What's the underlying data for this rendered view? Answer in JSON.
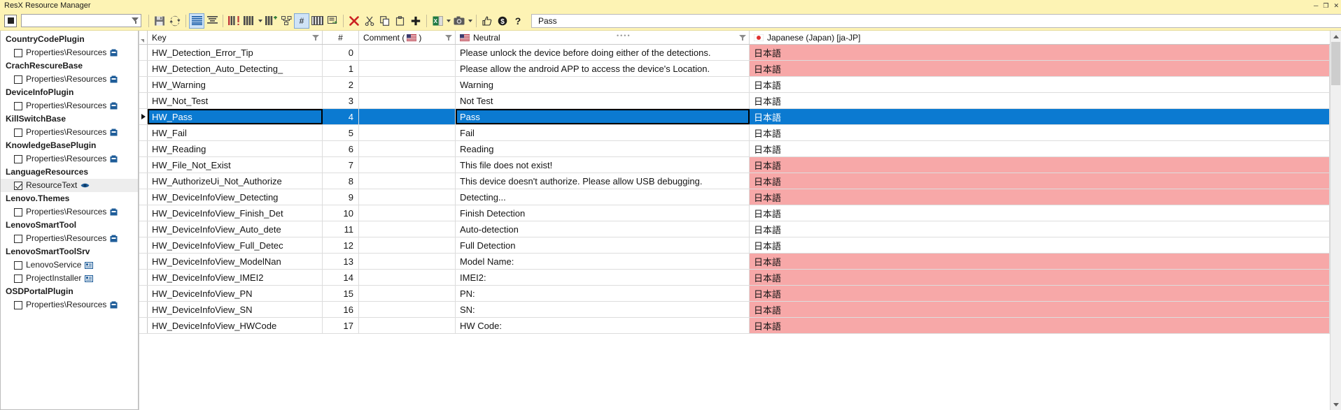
{
  "window": {
    "title": "ResX Resource Manager",
    "minimize": "─",
    "maximize": "❐",
    "close": "✕"
  },
  "toolbar": {
    "filter": {
      "value": "",
      "placeholder": ""
    },
    "search": {
      "value": "Pass",
      "placeholder": ""
    },
    "buttons": [
      {
        "name": "save-button",
        "label": "Save"
      },
      {
        "name": "reload-button",
        "label": "Reload"
      },
      {
        "name": "show-all-lines-button",
        "label": "Show all lines"
      },
      {
        "name": "show-only-used-button",
        "label": "Show only used"
      },
      {
        "name": "show-invariant-button",
        "label": "Show invariant"
      },
      {
        "name": "column-chooser-button",
        "label": "Columns"
      },
      {
        "name": "add-language-button",
        "label": "Add language"
      },
      {
        "name": "group-button",
        "label": "Group"
      },
      {
        "name": "toggle-key-column-button",
        "label": "#"
      },
      {
        "name": "toggle-comments-button",
        "label": "Comments"
      },
      {
        "name": "toggle-details-button",
        "label": "Details"
      },
      {
        "name": "delete-button",
        "label": "Delete"
      },
      {
        "name": "cut-button",
        "label": "Cut"
      },
      {
        "name": "copy-button",
        "label": "Copy"
      },
      {
        "name": "paste-button",
        "label": "Paste"
      },
      {
        "name": "add-button",
        "label": "Add"
      },
      {
        "name": "export-excel-button",
        "label": "Export to Excel"
      },
      {
        "name": "snapshot-button",
        "label": "Snapshot"
      },
      {
        "name": "feedback-button",
        "label": "Feedback"
      },
      {
        "name": "donate-button",
        "label": "Donate"
      },
      {
        "name": "help-button",
        "label": "?"
      }
    ]
  },
  "sidebar": {
    "groups": [
      {
        "name": "CountryCodePlugin",
        "children": [
          {
            "label": "Properties\\Resources",
            "checked": false,
            "icon": "resource-icon",
            "selected": false
          }
        ]
      },
      {
        "name": "CrachRescureBase",
        "children": [
          {
            "label": "Properties\\Resources",
            "checked": false,
            "icon": "resource-icon",
            "selected": false
          }
        ]
      },
      {
        "name": "DeviceInfoPlugin",
        "children": [
          {
            "label": "Properties\\Resources",
            "checked": false,
            "icon": "resource-icon",
            "selected": false
          }
        ]
      },
      {
        "name": "KillSwitchBase",
        "children": [
          {
            "label": "Properties\\Resources",
            "checked": false,
            "icon": "resource-icon",
            "selected": false
          }
        ]
      },
      {
        "name": "KnowledgeBasePlugin",
        "children": [
          {
            "label": "Properties\\Resources",
            "checked": false,
            "icon": "resource-icon",
            "selected": false
          }
        ]
      },
      {
        "name": "LanguageResources",
        "children": [
          {
            "label": "ResourceText",
            "checked": true,
            "icon": "eye-icon",
            "selected": true
          }
        ]
      },
      {
        "name": "Lenovo.Themes",
        "children": [
          {
            "label": "Properties\\Resources",
            "checked": false,
            "icon": "resource-icon",
            "selected": false
          }
        ]
      },
      {
        "name": "LenovoSmartTool",
        "children": [
          {
            "label": "Properties\\Resources",
            "checked": false,
            "icon": "resource-icon",
            "selected": false
          }
        ]
      },
      {
        "name": "LenovoSmartToolSrv",
        "children": [
          {
            "label": "LenovoService",
            "checked": false,
            "icon": "form-icon",
            "selected": false
          },
          {
            "label": "ProjectInstaller",
            "checked": false,
            "icon": "form-icon",
            "selected": false
          }
        ]
      },
      {
        "name": "OSDPortalPlugin",
        "children": [
          {
            "label": "Properties\\Resources",
            "checked": false,
            "icon": "resource-icon",
            "selected": false
          }
        ]
      }
    ]
  },
  "grid": {
    "columns": [
      {
        "key": "key",
        "label": "Key",
        "filterable": true,
        "flag": null
      },
      {
        "key": "index",
        "label": "#",
        "filterable": false,
        "flag": null
      },
      {
        "key": "comment",
        "label": "Comment (",
        "suffix": ")",
        "filterable": true,
        "flag": "us"
      },
      {
        "key": "neutral",
        "label": "Neutral",
        "filterable": false,
        "flag": "us"
      },
      {
        "key": "ja",
        "label": "Japanese (Japan) [ja-JP]",
        "filterable": false,
        "flag": "jp"
      }
    ],
    "selected_row_index": 4,
    "rows": [
      {
        "key": "HW_Detection_Error_Tip",
        "index": "0",
        "comment": "",
        "neutral": "Please unlock the device before doing either of the detections.",
        "ja": "日本語",
        "ja_warn": true
      },
      {
        "key": "HW_Detection_Auto_Detecting_",
        "index": "1",
        "comment": "",
        "neutral": "Please allow the android APP to access the device's Location.",
        "ja": "日本語",
        "ja_warn": true
      },
      {
        "key": "HW_Warning",
        "index": "2",
        "comment": "",
        "neutral": "Warning",
        "ja": "日本語",
        "ja_warn": false
      },
      {
        "key": "HW_Not_Test",
        "index": "3",
        "comment": "",
        "neutral": "Not Test",
        "ja": "日本語",
        "ja_warn": false
      },
      {
        "key": "HW_Pass",
        "index": "4",
        "comment": "",
        "neutral": "Pass",
        "ja": "日本語",
        "ja_warn": false
      },
      {
        "key": "HW_Fail",
        "index": "5",
        "comment": "",
        "neutral": "Fail",
        "ja": "日本語",
        "ja_warn": false
      },
      {
        "key": "HW_Reading",
        "index": "6",
        "comment": "",
        "neutral": "Reading",
        "ja": "日本語",
        "ja_warn": false
      },
      {
        "key": "HW_File_Not_Exist",
        "index": "7",
        "comment": "",
        "neutral": "This file does not exist!",
        "ja": "日本語",
        "ja_warn": true
      },
      {
        "key": "HW_AuthorizeUi_Not_Authorize",
        "index": "8",
        "comment": "",
        "neutral": "This device doesn't authorize. Please allow USB debugging.",
        "ja": "日本語",
        "ja_warn": true
      },
      {
        "key": "HW_DeviceInfoView_Detecting",
        "index": "9",
        "comment": "",
        "neutral": "Detecting...",
        "ja": "日本語",
        "ja_warn": true
      },
      {
        "key": "HW_DeviceInfoView_Finish_Det",
        "index": "10",
        "comment": "",
        "neutral": "Finish Detection",
        "ja": "日本語",
        "ja_warn": false
      },
      {
        "key": "HW_DeviceInfoView_Auto_dete",
        "index": "11",
        "comment": "",
        "neutral": "Auto-detection",
        "ja": "日本語",
        "ja_warn": false
      },
      {
        "key": "HW_DeviceInfoView_Full_Detec",
        "index": "12",
        "comment": "",
        "neutral": "Full Detection",
        "ja": "日本語",
        "ja_warn": false
      },
      {
        "key": "HW_DeviceInfoView_ModelNan",
        "index": "13",
        "comment": "",
        "neutral": "Model Name:",
        "ja": "日本語",
        "ja_warn": true
      },
      {
        "key": "HW_DeviceInfoView_IMEI2",
        "index": "14",
        "comment": "",
        "neutral": "IMEI2:",
        "ja": "日本語",
        "ja_warn": true
      },
      {
        "key": "HW_DeviceInfoView_PN",
        "index": "15",
        "comment": "",
        "neutral": "PN:",
        "ja": "日本語",
        "ja_warn": true
      },
      {
        "key": "HW_DeviceInfoView_SN",
        "index": "16",
        "comment": "",
        "neutral": "SN:",
        "ja": "日本語",
        "ja_warn": true
      },
      {
        "key": "HW_DeviceInfoView_HWCode",
        "index": "17",
        "comment": "",
        "neutral": "HW Code:",
        "ja": "日本語",
        "ja_warn": true
      }
    ]
  },
  "colors": {
    "title_bar": "#fdf3b4",
    "selection": "#0b7ad1",
    "warning_cell": "#f7a8a8"
  }
}
